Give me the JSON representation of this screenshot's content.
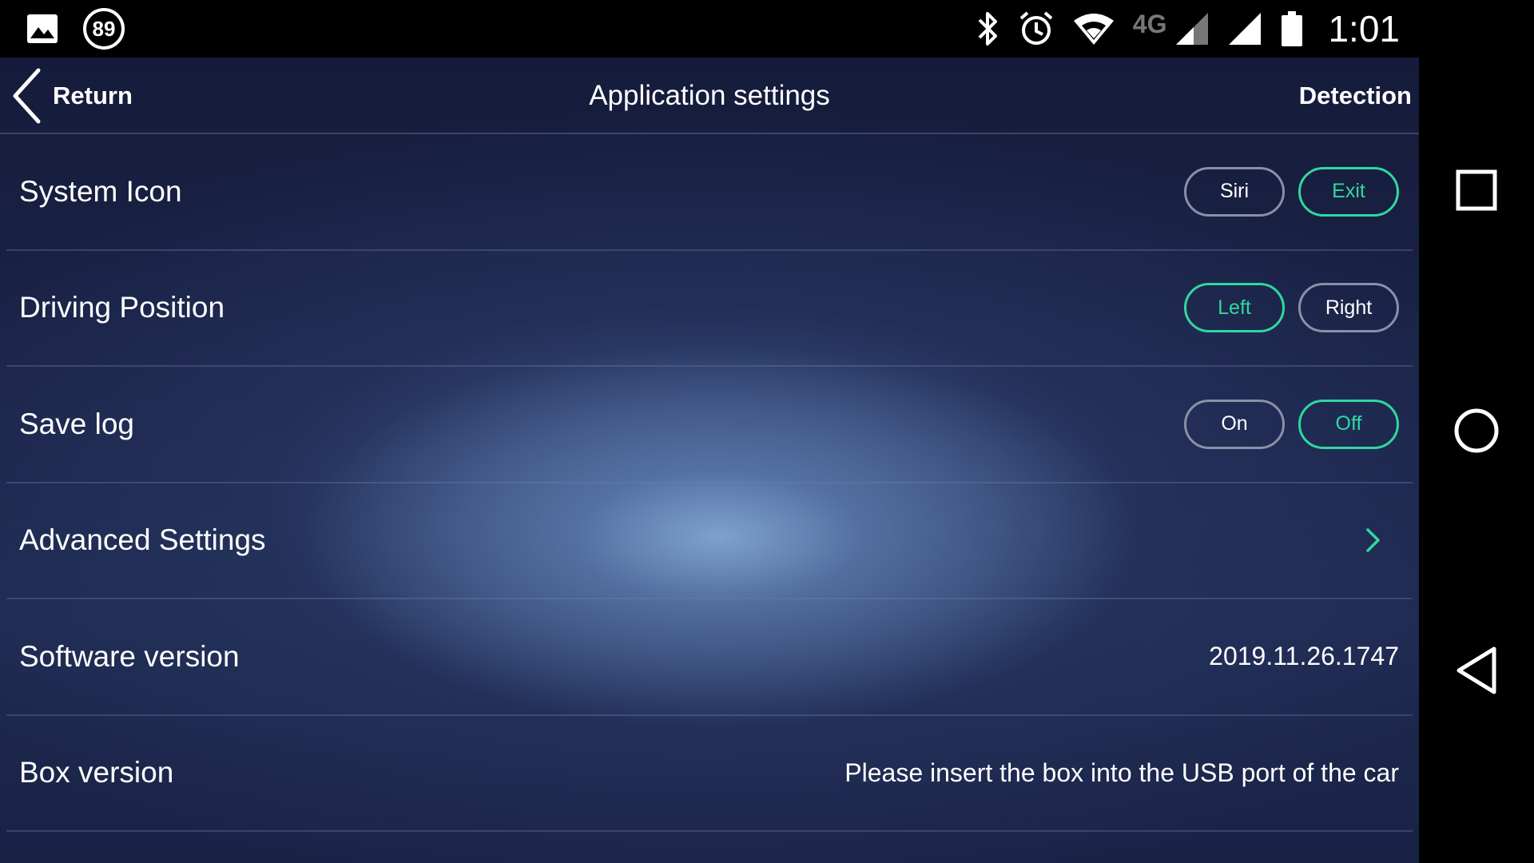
{
  "status_bar": {
    "notification_count": "89",
    "network_type": "4G",
    "time": "1:01",
    "icons": [
      "gallery-icon",
      "bluetooth-icon",
      "alarm-icon",
      "wifi-icon",
      "signal-icon",
      "battery-icon"
    ]
  },
  "header": {
    "back_label": "Return",
    "title": "Application settings",
    "action_label": "Detection"
  },
  "rows": {
    "system_icon": {
      "label": "System Icon",
      "options": [
        "Siri",
        "Exit"
      ],
      "selected": "Exit"
    },
    "driving_position": {
      "label": "Driving Position",
      "options": [
        "Left",
        "Right"
      ],
      "selected": "Left"
    },
    "save_log": {
      "label": "Save log",
      "options": [
        "On",
        "Off"
      ],
      "selected": "Off"
    },
    "advanced_settings": {
      "label": "Advanced Settings"
    },
    "software_version": {
      "label": "Software version",
      "value": "2019.11.26.1747"
    },
    "box_version": {
      "label": "Box version",
      "value": "Please insert the box into the USB port of the car"
    }
  },
  "colors": {
    "accent": "#2fd8a0",
    "inactive_border": "#8a90a8",
    "background_top": "#151b3a",
    "glow": "#82a5d2"
  },
  "nav_bar": {
    "icons": [
      "overview-icon",
      "home-icon",
      "back-icon"
    ]
  }
}
